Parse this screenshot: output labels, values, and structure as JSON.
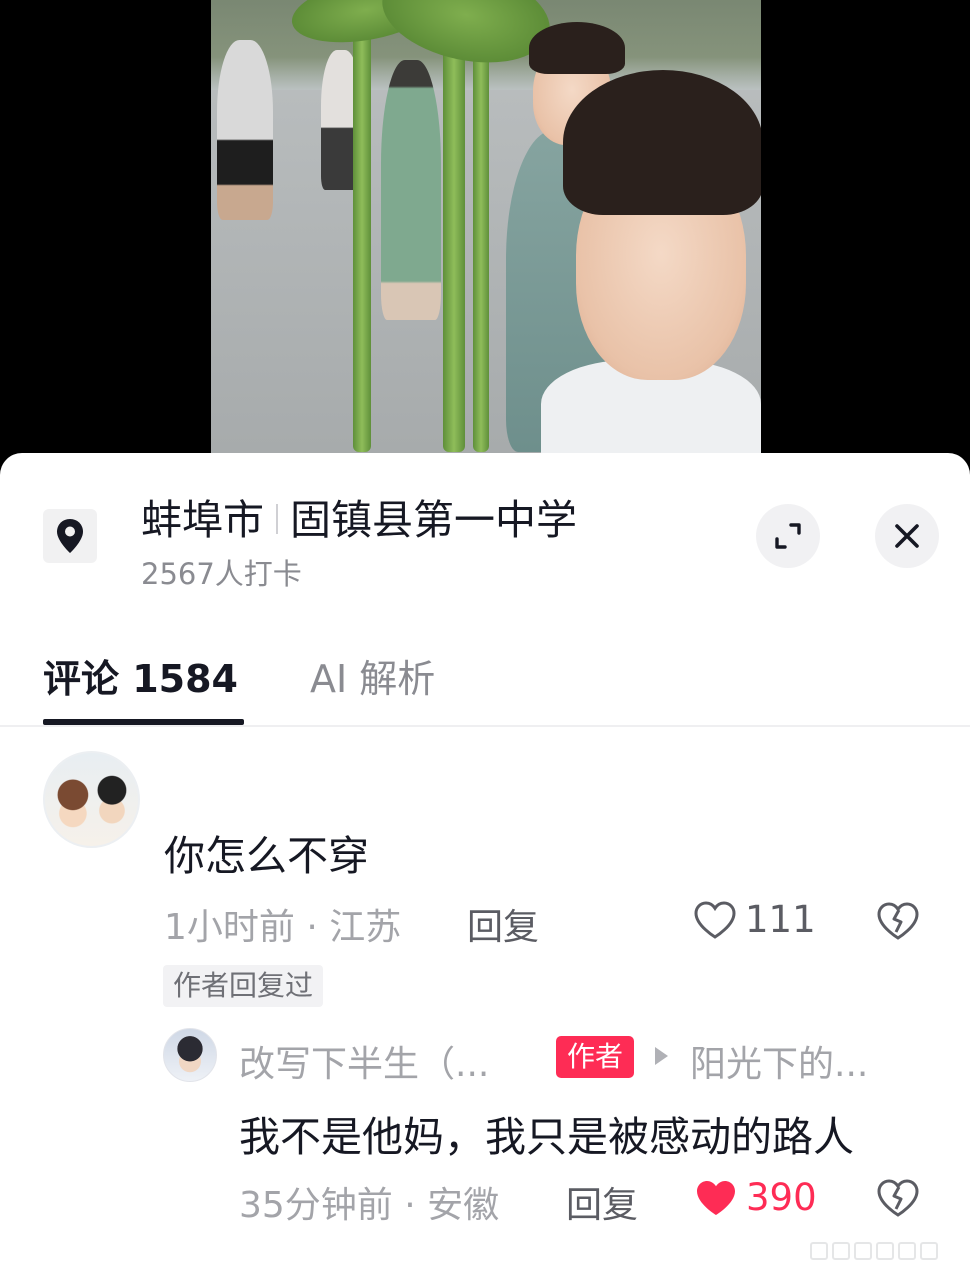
{
  "location": {
    "city": "蚌埠市",
    "place": "固镇县第一中学",
    "checkins": "2567人打卡"
  },
  "tabs": [
    {
      "label": "评论 1584"
    },
    {
      "label": "AI 解析"
    }
  ],
  "comment": {
    "text": "你怎么不穿",
    "time_region": "1小时前 · 江苏",
    "reply_label": "回复",
    "likes": "111",
    "author_replied_tag": "作者回复过"
  },
  "reply": {
    "user": "改写下半生（...",
    "author_badge": "作者",
    "target": "阳光下的...",
    "text": "我不是他妈，我只是被感动的路人",
    "time_region": "35分钟前 · 安徽",
    "reply_label": "回复",
    "likes": "390"
  },
  "colors": {
    "accent": "#fe2c55",
    "text_primary": "#161823",
    "text_secondary": "#a3a4a9"
  },
  "icons": {
    "location": "map-pin-icon",
    "expand": "expand-icon",
    "close": "close-icon",
    "like": "heart-icon",
    "dislike": "broken-heart-icon"
  }
}
